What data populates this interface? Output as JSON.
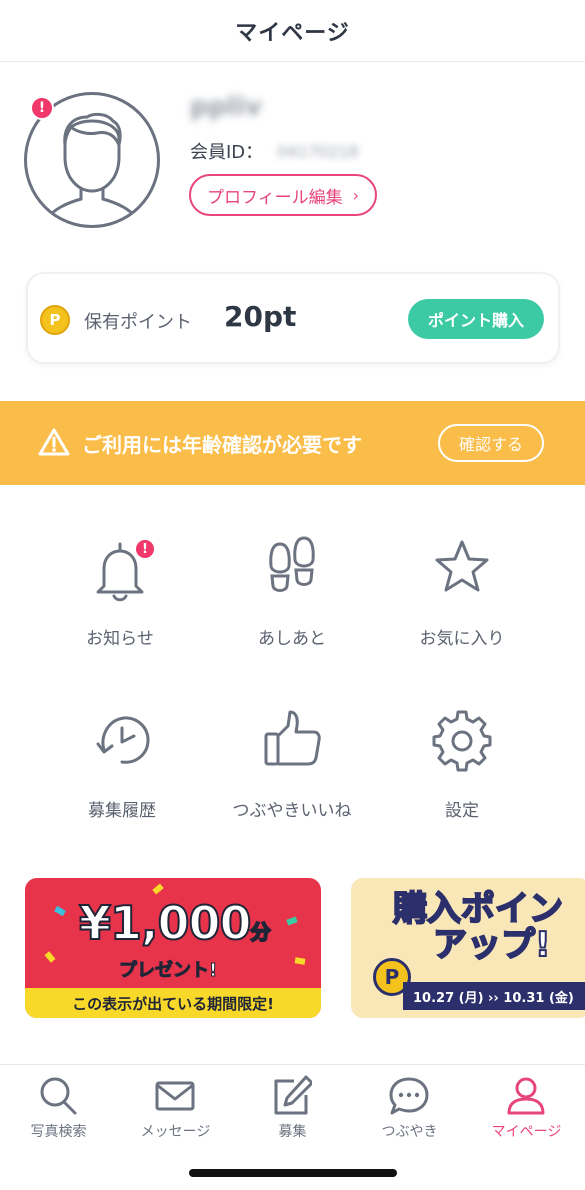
{
  "header": {
    "title": "マイページ"
  },
  "profile": {
    "username": "ppliv",
    "member_label": "会員ID：",
    "member_id": "04170218",
    "alert": "!",
    "edit_label": "プロフィール編集",
    "edit_chevron": "›"
  },
  "points": {
    "coin_letter": "P",
    "label": "保有ポイント",
    "value": "20pt",
    "buy_label": "ポイント購入"
  },
  "age_banner": {
    "text": "ご利用には年齢確認が必要です",
    "button": "確認する",
    "color": "#fbbd4a"
  },
  "menu": {
    "items": [
      {
        "label": "お知らせ",
        "icon": "bell-icon",
        "alert": "!"
      },
      {
        "label": "あしあと",
        "icon": "footprints-icon"
      },
      {
        "label": "お気に入り",
        "icon": "star-icon"
      },
      {
        "label": "募集履歴",
        "icon": "history-clock-icon"
      },
      {
        "label": "つぶやきいいね",
        "icon": "thumbs-up-icon"
      },
      {
        "label": "設定",
        "icon": "gear-icon"
      }
    ]
  },
  "promos": [
    {
      "amount": "¥1,000",
      "amount_unit": "分",
      "sub": "プレゼント!",
      "strip": "この表示が出ている期間限定!"
    },
    {
      "title_line1": "購入ポイン",
      "title_line2": "アップ!",
      "coin_letter": "P",
      "date": "10.27 (月) ›› 10.31 (金)"
    }
  ],
  "tabbar": {
    "tabs": [
      {
        "label": "写真検索",
        "icon": "search-icon",
        "active": false
      },
      {
        "label": "メッセージ",
        "icon": "mail-icon",
        "active": false
      },
      {
        "label": "募集",
        "icon": "edit-icon",
        "active": false
      },
      {
        "label": "つぶやき",
        "icon": "chat-bubble-icon",
        "active": false
      },
      {
        "label": "マイページ",
        "icon": "person-icon",
        "active": true
      }
    ],
    "active_color": "#e8457a"
  }
}
